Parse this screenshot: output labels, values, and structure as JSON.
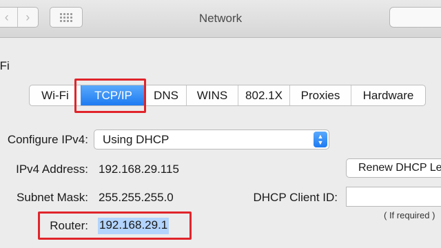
{
  "window": {
    "title": "Network",
    "back_glyph": "‹",
    "forward_glyph": "›"
  },
  "service": {
    "name_visible": "-Fi"
  },
  "tabs": [
    {
      "label": "Wi-Fi",
      "active": false
    },
    {
      "label": "TCP/IP",
      "active": true
    },
    {
      "label": "DNS",
      "active": false
    },
    {
      "label": "WINS",
      "active": false
    },
    {
      "label": "802.1X",
      "active": false
    },
    {
      "label": "Proxies",
      "active": false
    },
    {
      "label": "Hardware",
      "active": false
    }
  ],
  "form": {
    "configure_label": "Configure IPv4:",
    "configure_value": "Using DHCP",
    "ipv4_label": "IPv4 Address:",
    "ipv4_value": "192.168.29.115",
    "subnet_label": "Subnet Mask:",
    "subnet_value": "255.255.255.0",
    "router_label": "Router:",
    "router_value": "192.168.29.1",
    "renew_label": "Renew DHCP Lease",
    "client_id_label": "DHCP Client ID:",
    "client_id_value": "",
    "if_required": "( If required )"
  },
  "colors": {
    "accent_blue": "#1d7bf2",
    "highlight_red": "#e0242a",
    "selection": "#b3d4fc"
  },
  "icons": {
    "back": "chevron-left-icon",
    "forward": "chevron-right-icon",
    "show_all": "grid-icon",
    "popup_arrows": "up-down-arrows-icon"
  }
}
